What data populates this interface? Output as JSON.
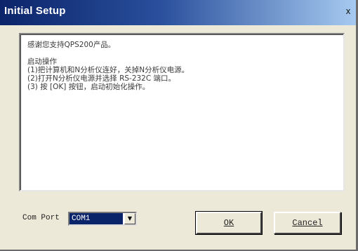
{
  "window": {
    "title": "Initial Setup",
    "close_glyph": "x",
    "colors": {
      "titlebar_start": "#0b246a",
      "titlebar_end": "#a6caf0",
      "dialog_bg": "#ece9d8",
      "selection": "#0a246a"
    }
  },
  "message": {
    "lines": [
      "感谢您支持QPS200产品。",
      "",
      "启动操作",
      "(1)把计算机和N分析仪连好，关掉N分析仪电源。",
      "(2)打开N分析仪电源并选择 RS-232C 端口。",
      "(3) 按 [OK] 按钮，启动初始化操作。"
    ]
  },
  "com_port": {
    "label": "Com Port",
    "selected": "COM1",
    "arrow_icon": "chevron-down-icon"
  },
  "buttons": {
    "ok_label": "OK",
    "cancel_label": "Cancel"
  }
}
